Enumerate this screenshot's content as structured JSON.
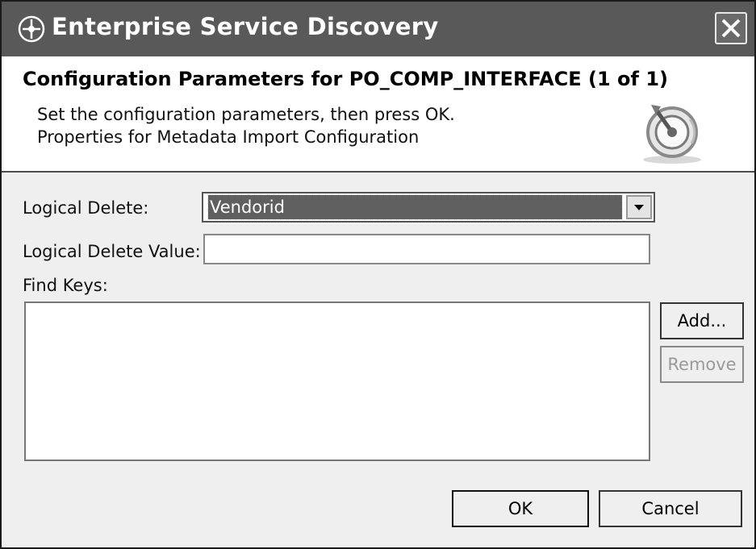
{
  "window": {
    "title": "Enterprise Service Discovery"
  },
  "banner": {
    "heading": "Configuration Parameters for PO_COMP_INTERFACE (1 of 1)",
    "line1": "Set the configuration parameters, then press OK.",
    "line2": "Properties for Metadata Import Configuration"
  },
  "form": {
    "logical_delete_label": "Logical Delete:",
    "logical_delete_value": "Vendorid",
    "logical_delete_value_label": "Logical Delete Value:",
    "logical_delete_value_field": "",
    "find_keys_label": "Find Keys:",
    "find_keys": []
  },
  "buttons": {
    "add": "Add...",
    "remove": "Remove",
    "ok": "OK",
    "cancel": "Cancel"
  },
  "icons": {
    "app": "enterprise-discovery-icon",
    "close": "close-icon",
    "wizard": "wizard-graphic-icon",
    "dropdown": "dropdown-arrow-icon"
  }
}
